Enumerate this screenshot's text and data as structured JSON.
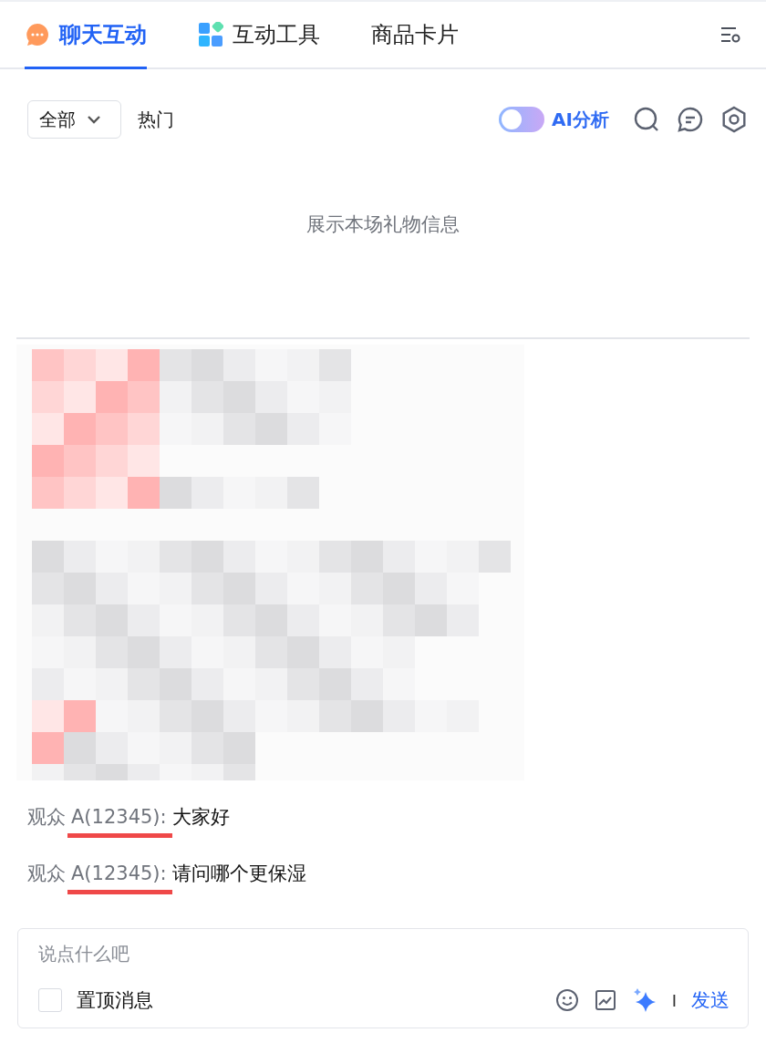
{
  "tabs": [
    {
      "label": "聊天互动",
      "kind": "chat",
      "selected": true
    },
    {
      "label": "互动工具",
      "kind": "tiles",
      "selected": false
    },
    {
      "label": "商品卡片",
      "selected": false
    }
  ],
  "filter": {
    "dropdown": "全部",
    "hot": "热门"
  },
  "ai_toggle": {
    "label": "AI分析",
    "on": false
  },
  "gift_panel": {
    "empty_text": "展示本场礼物信息"
  },
  "messages": [
    {
      "viewer": "观众",
      "id": "A(12345):",
      "text": "大家好",
      "underlined": true
    },
    {
      "viewer": "观众",
      "id": "A(12345):",
      "text": "请问哪个更保湿",
      "underlined": true
    }
  ],
  "composer": {
    "placeholder": "说点什么吧",
    "pin": {
      "label": "置顶消息",
      "checked": false
    },
    "separator": "I",
    "send": "发送"
  }
}
